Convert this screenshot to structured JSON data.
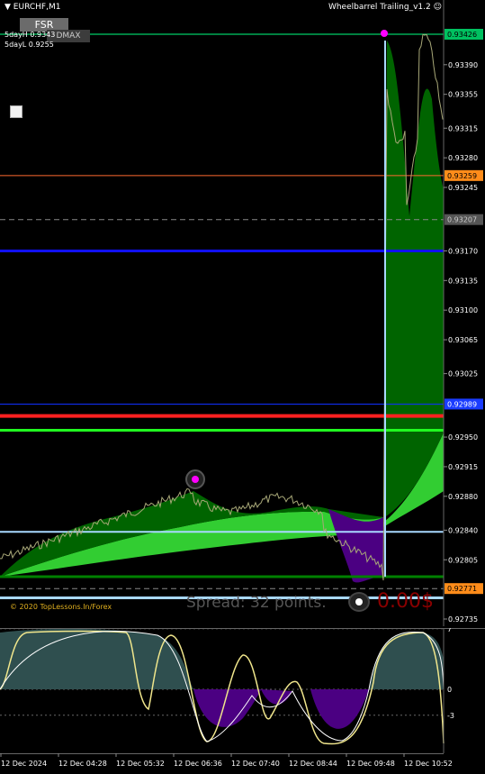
{
  "window": {
    "symbol": "EURCHF,M1",
    "ea_name": "Wheelbarrel Trailing_v1.2",
    "ea_icon": "smiley-icon"
  },
  "buttons": {
    "fsr": "FSR",
    "dmax": "DMAX"
  },
  "stats": {
    "day_high": "5dayH 0.9343",
    "day_low": "5dayL 0.9255"
  },
  "footer": {
    "copyright": "© 2020 TopLessons.In/Forex",
    "spread": "Spread: 32 points.",
    "pnl": "0.00$"
  },
  "price_axis": {
    "ticks": [
      "0.93390",
      "0.93355",
      "0.93315",
      "0.93280",
      "0.93245",
      "0.93170",
      "0.93135",
      "0.93100",
      "0.93065",
      "0.93025",
      "0.92950",
      "0.92915",
      "0.92880",
      "0.92840",
      "0.92805",
      "0.92735"
    ],
    "tick_values": [
      0.9339,
      0.93355,
      0.93315,
      0.9328,
      0.93245,
      0.9317,
      0.93135,
      0.931,
      0.93065,
      0.93025,
      0.9295,
      0.92915,
      0.9288,
      0.9284,
      0.92805,
      0.92735
    ],
    "labels": [
      {
        "text": "0.93426",
        "value": 0.93426,
        "bg": "#00c060",
        "fg": "#000000"
      },
      {
        "text": "0.93259",
        "value": 0.93259,
        "bg": "#ff8c1a",
        "fg": "#000000"
      },
      {
        "text": "0.93207",
        "value": 0.93207,
        "bg": "#555555",
        "fg": "#cccccc"
      },
      {
        "text": "0.92989",
        "value": 0.92989,
        "bg": "#1a3cff",
        "fg": "#ffffff"
      },
      {
        "text": "0.92771",
        "value": 0.92771,
        "bg": "#ff8c1a",
        "fg": "#000000"
      }
    ]
  },
  "levels": [
    {
      "value": 0.93426,
      "color": "#00ff80",
      "width": 1,
      "dash": false
    },
    {
      "value": 0.93259,
      "color": "#ff6a30",
      "width": 1,
      "dash": false
    },
    {
      "value": 0.93207,
      "color": "#888888",
      "width": 1,
      "dash": true
    },
    {
      "value": 0.9317,
      "color": "#1010ff",
      "width": 3,
      "dash": false
    },
    {
      "value": 0.92989,
      "color": "#1030ff",
      "width": 1,
      "dash": false
    },
    {
      "value": 0.92975,
      "color": "#ff2020",
      "width": 4,
      "dash": false
    },
    {
      "value": 0.92958,
      "color": "#20ff20",
      "width": 3,
      "dash": false
    },
    {
      "value": 0.92838,
      "color": "#a8d8ff",
      "width": 2,
      "dash": false
    },
    {
      "value": 0.92785,
      "color": "#008000",
      "width": 3,
      "dash": false
    },
    {
      "value": 0.92771,
      "color": "#888888",
      "width": 1,
      "dash": true
    },
    {
      "value": 0.9276,
      "color": "#a8d8ff",
      "width": 3,
      "dash": false
    }
  ],
  "colors": {
    "background": "#000000",
    "fill_up": "#006400",
    "fill_up_light": "#32cd32",
    "fill_down": "#4b0082",
    "price_line": "#a8a878",
    "marker": "#ff00ff",
    "osc_fill_up": "#2f4f4f",
    "osc_fill_down": "#4b0082",
    "osc_line": "#f0e68c"
  },
  "oscillator": {
    "levels": [
      "7",
      "0",
      "-3"
    ]
  },
  "time_axis": [
    "12 Dec 2024",
    "12 Dec 04:28",
    "12 Dec 05:32",
    "12 Dec 06:36",
    "12 Dec 07:40",
    "12 Dec 08:44",
    "12 Dec 09:48",
    "12 Dec 10:52"
  ]
}
